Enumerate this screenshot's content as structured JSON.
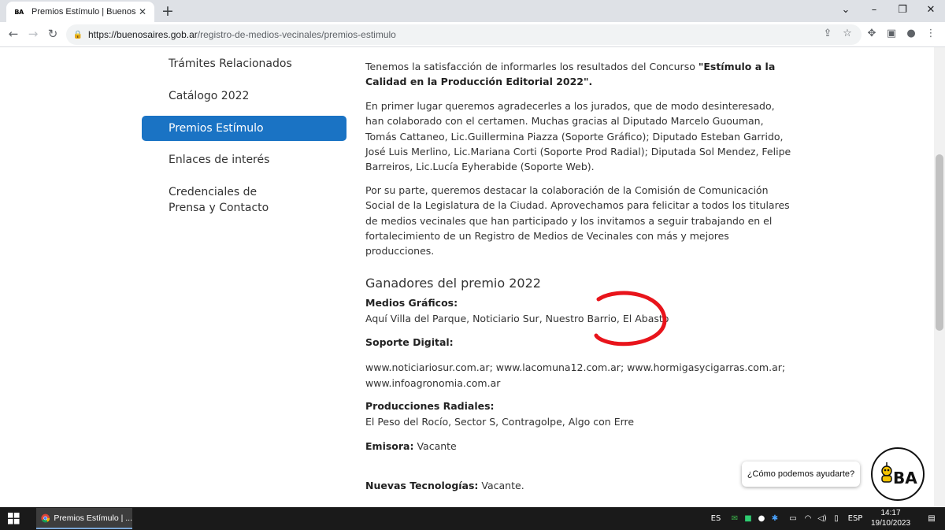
{
  "browser": {
    "tab": {
      "favicon_text": "BA",
      "title": "Premios Estímulo | Buenos Aires"
    },
    "url": {
      "domain": "https://buenosaires.gob.ar",
      "path": "/registro-de-medios-vecinales/premios-estimulo"
    }
  },
  "sidebar": {
    "items": [
      {
        "label": "Trámites Relacionados",
        "active": false
      },
      {
        "label": "Catálogo 2022",
        "active": false
      },
      {
        "label": "Premios Estímulo",
        "active": true
      },
      {
        "label": "Enlaces de interés",
        "active": false
      },
      {
        "label": "Credenciales de Prensa y Contacto",
        "active": false
      }
    ]
  },
  "content": {
    "intro_text": "Tenemos la satisfacción de informarles los resultados del Concurso ",
    "intro_bold": "\"Estímulo a la Calidad en la Producción Editorial 2022\".",
    "para2": "En primer lugar queremos agradecerles a los jurados, que de modo desinteresado, han colaborado con el certamen. Muchas gracias al Diputado Marcelo Guouman, Tomás Cattaneo, Lic.Guillermina Piazza (Soporte Gráfico); Diputado Esteban Garrido, José Luis Merlino, Lic.Mariana Corti (Soporte Prod Radial); Diputada Sol Mendez, Felipe Barreiros, Lic.Lucía Eyherabide (Soporte Web).",
    "para3": "Por su parte, queremos destacar la colaboración de la Comisión de Comunicación Social de la Legislatura de la Ciudad. Aprovechamos para felicitar a todos los titulares de medios vecinales que han participado y los invitamos a seguir trabajando en el fortalecimiento de un Registro de Medios de Vecinales  con más y mejores producciones.",
    "winners_heading": "Ganadores del premio 2022",
    "graficos_label": "Medios Gráficos:",
    "graficos_value": "Aquí Villa del Parque, Noticiario Sur, Nuestro Barrio, El Abasto",
    "digital_label": "Soporte Digital:",
    "digital_value": "www.noticiariosur.com.ar; www.lacomuna12.com.ar; www.hormigasycigarras.com.ar; www.infoagronomia.com.ar",
    "radiales_label": "Producciones Radiales:",
    "radiales_value": "El Peso del Rocío, Sector S, Contragolpe, Algo con Erre",
    "emisora_label": "Emisora:",
    "emisora_value": " Vacante",
    "nuevas_label": "Nuevas Tecnologías:",
    "nuevas_value": " Vacante."
  },
  "chat": {
    "prompt": "¿Cómo podemos ayudarte?",
    "logo_text": "BA"
  },
  "taskbar": {
    "app_title": "Premios Estímulo | ...",
    "lang_short": "ES",
    "lang_code": "ESP",
    "time": "14:17",
    "date": "19/10/2023"
  },
  "colors": {
    "accent": "#1a73c4",
    "annotation": "#e8141b"
  }
}
